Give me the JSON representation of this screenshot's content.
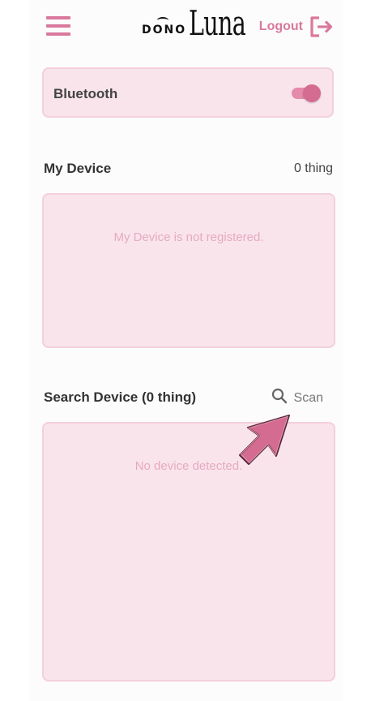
{
  "header": {
    "logo_small": "DONO",
    "logo_large": "Luna",
    "logout_label": "Logout"
  },
  "bluetooth": {
    "label": "Bluetooth",
    "enabled": true
  },
  "my_device": {
    "title": "My Device",
    "count": "0 thing",
    "empty_text": "My Device is not registered."
  },
  "search_device": {
    "title": "Search Device (0 thing)",
    "scan_label": "Scan",
    "empty_text": "No device detected."
  },
  "colors": {
    "accent": "#d9799c",
    "card_bg": "#f9e4ec",
    "card_border": "#f4cfdc"
  },
  "icons": {
    "menu": "hamburger-menu-icon",
    "logout": "logout-icon",
    "search": "search-icon",
    "pointer": "pointer-arrow-icon"
  }
}
